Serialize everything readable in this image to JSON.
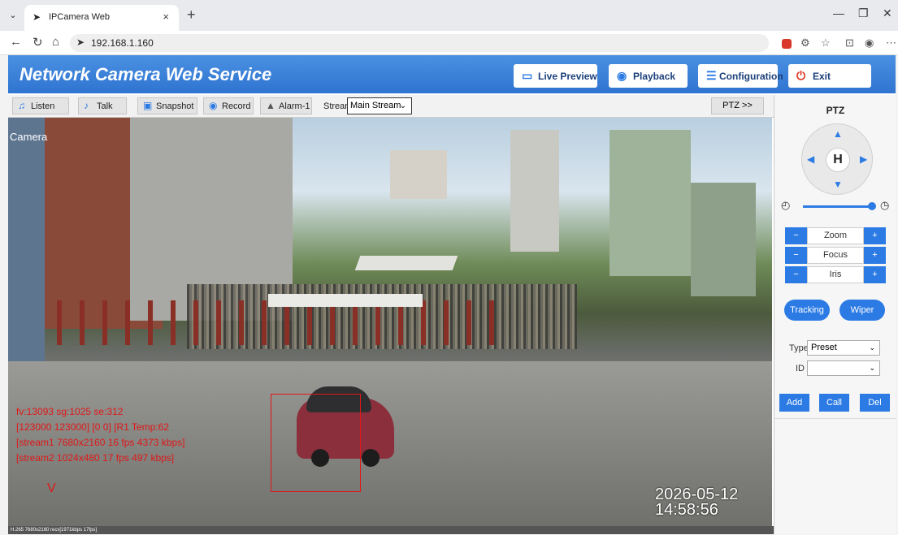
{
  "browser": {
    "tab_title": "IPCamera Web",
    "url": "192.168.1.160",
    "tab_close": "×",
    "new_tab": "+"
  },
  "app": {
    "brand": "Network Camera Web Service",
    "nav": {
      "live_preview": "Live Preview",
      "playback": "Playback",
      "configuration": "Configuration",
      "exit": "Exit"
    }
  },
  "toolbar": {
    "listen": "Listen",
    "talk": "Talk",
    "snapshot": "Snapshot",
    "record": "Record",
    "alarm": "Alarm-1",
    "stream_label": "Stream",
    "stream_value": "Main Stream",
    "ptz_toggle": "PTZ >>"
  },
  "video": {
    "camera_label": "Camera",
    "osd_lines": [
      "fv:13093 sg:1025 se:312",
      "[123000 123000] [0 0] [R1 Temp:62",
      "[stream1 7680x2160 16 fps 4373 kbps]",
      "[stream2 1024x480 17 fps 497 kbps]"
    ],
    "osd_v": "V",
    "timestamp": "2026-05-12 14:58:56",
    "status": "H.265 7680x2160 recv[1971kbps 17fps]"
  },
  "ptz": {
    "title": "PTZ",
    "home": "H",
    "rows": [
      "Zoom",
      "Focus",
      "Iris"
    ],
    "minus": "−",
    "plus": "+",
    "tracking": "Tracking",
    "wiper": "Wiper",
    "type_label": "Type",
    "type_value": "Preset",
    "id_label": "ID",
    "id_value": "",
    "add": "Add",
    "call": "Call",
    "del": "Del"
  },
  "colors": {
    "accent": "#2c7be5",
    "header": "#3a82db",
    "osd_red": "#e01818"
  }
}
